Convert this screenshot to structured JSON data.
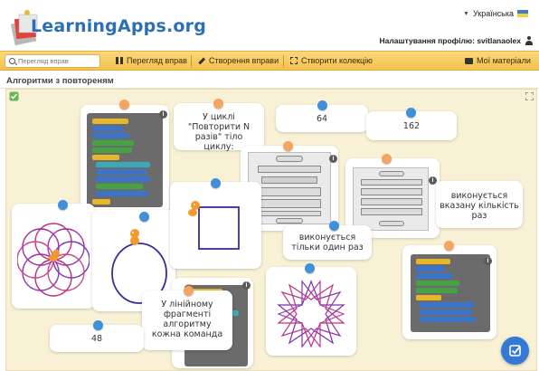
{
  "header": {
    "logo_text": "LearningApps.org",
    "language": "Українська",
    "profile_text": "Налаштування профілю: svitlanaolex"
  },
  "nav": {
    "search_placeholder": "Перегляд вправ",
    "items": [
      {
        "label": "Перегляд вправ",
        "icon": "grid-icon"
      },
      {
        "label": "Створення вправи",
        "icon": "pencil-icon"
      },
      {
        "label": "Створити колекцію",
        "icon": "collection-icon"
      },
      {
        "label": "Мої матеріали",
        "icon": "folder-icon"
      }
    ]
  },
  "page_title": "Алгоритми з повтореням",
  "cards": {
    "in_cycle_text": "У циклі \"Повторити N разів\" тіло циклу:",
    "num_64": "64",
    "num_162": "162",
    "executes_n_times": "виконується вказану кількість раз",
    "executes_once": "виконується тільки один раз",
    "linear_fragment": "У лінійному фрагменті алгоритму кожна команда",
    "num_48": "48"
  },
  "colors": {
    "nav_bg": "#f5c14e",
    "board_bg": "#f8f1d6",
    "pin_orange": "#f5a562",
    "pin_blue": "#3f8fdb",
    "logo_blue": "#2d6fb5",
    "check_button": "#3479d8"
  }
}
